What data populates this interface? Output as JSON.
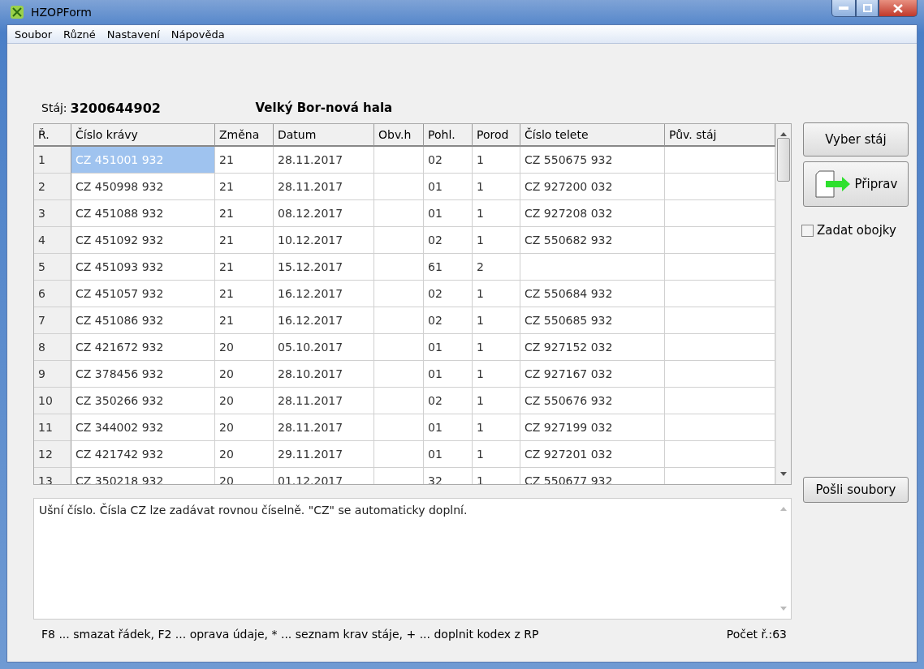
{
  "window": {
    "title": "HZOPForm"
  },
  "menu": [
    "Soubor",
    "Různé",
    "Nastavení",
    "Nápověda"
  ],
  "stable": {
    "label": "Stáj:",
    "number": "3200644902",
    "name": "Velký Bor-nová hala"
  },
  "table": {
    "columns": [
      "Ř.",
      "Číslo krávy",
      "Změna",
      "Datum",
      "Obv.h",
      "Pohl.",
      "Porod",
      "Číslo telete",
      "Pův. stáj"
    ],
    "rows": [
      {
        "selected": true,
        "cells": [
          "1",
          "CZ 451001 932",
          "21",
          "28.11.2017",
          "",
          "02",
          "1",
          "CZ 550675 932",
          ""
        ]
      },
      {
        "selected": false,
        "cells": [
          "2",
          "CZ 450998 932",
          "21",
          "28.11.2017",
          "",
          "01",
          "1",
          "CZ 927200 032",
          ""
        ]
      },
      {
        "selected": false,
        "cells": [
          "3",
          "CZ 451088 932",
          "21",
          "08.12.2017",
          "",
          "01",
          "1",
          "CZ 927208 032",
          ""
        ]
      },
      {
        "selected": false,
        "cells": [
          "4",
          "CZ 451092 932",
          "21",
          "10.12.2017",
          "",
          "02",
          "1",
          "CZ 550682 932",
          ""
        ]
      },
      {
        "selected": false,
        "cells": [
          "5",
          "CZ 451093 932",
          "21",
          "15.12.2017",
          "",
          "61",
          "2",
          "",
          ""
        ]
      },
      {
        "selected": false,
        "cells": [
          "6",
          "CZ 451057 932",
          "21",
          "16.12.2017",
          "",
          "02",
          "1",
          "CZ 550684 932",
          ""
        ]
      },
      {
        "selected": false,
        "cells": [
          "7",
          "CZ 451086 932",
          "21",
          "16.12.2017",
          "",
          "02",
          "1",
          "CZ 550685 932",
          ""
        ]
      },
      {
        "selected": false,
        "cells": [
          "8",
          "CZ 421672 932",
          "20",
          "05.10.2017",
          "",
          "01",
          "1",
          "CZ 927152 032",
          ""
        ]
      },
      {
        "selected": false,
        "cells": [
          "9",
          "CZ 378456 932",
          "20",
          "28.10.2017",
          "",
          "01",
          "1",
          "CZ 927167 032",
          ""
        ]
      },
      {
        "selected": false,
        "cells": [
          "10",
          "CZ 350266 932",
          "20",
          "28.11.2017",
          "",
          "02",
          "1",
          "CZ 550676 932",
          ""
        ]
      },
      {
        "selected": false,
        "cells": [
          "11",
          "CZ 344002 932",
          "20",
          "28.11.2017",
          "",
          "01",
          "1",
          "CZ 927199 032",
          ""
        ]
      },
      {
        "selected": false,
        "cells": [
          "12",
          "CZ 421742 932",
          "20",
          "29.11.2017",
          "",
          "01",
          "1",
          "CZ 927201 032",
          ""
        ]
      },
      {
        "selected": false,
        "cells": [
          "13",
          "CZ 350218 932",
          "20",
          "01.12.2017",
          "",
          "32",
          "1",
          "CZ 550677 932",
          ""
        ]
      }
    ]
  },
  "buttons": {
    "select_stable": "Vyber stáj",
    "prepare": "Připrav",
    "send_files": "Pošli soubory"
  },
  "collars_checkbox": {
    "label": "Zadat obojky",
    "checked": false
  },
  "help_text": "Ušní číslo. Čísla CZ lze zadávat rovnou číselně. \"CZ\" se automaticky doplní.",
  "status_bar": {
    "hint": "F8 ... smazat řádek, F2 ... oprava údaje, * ... seznam krav stáje, + ... doplnit kodex z RP",
    "count": "Počet ř.:63"
  }
}
